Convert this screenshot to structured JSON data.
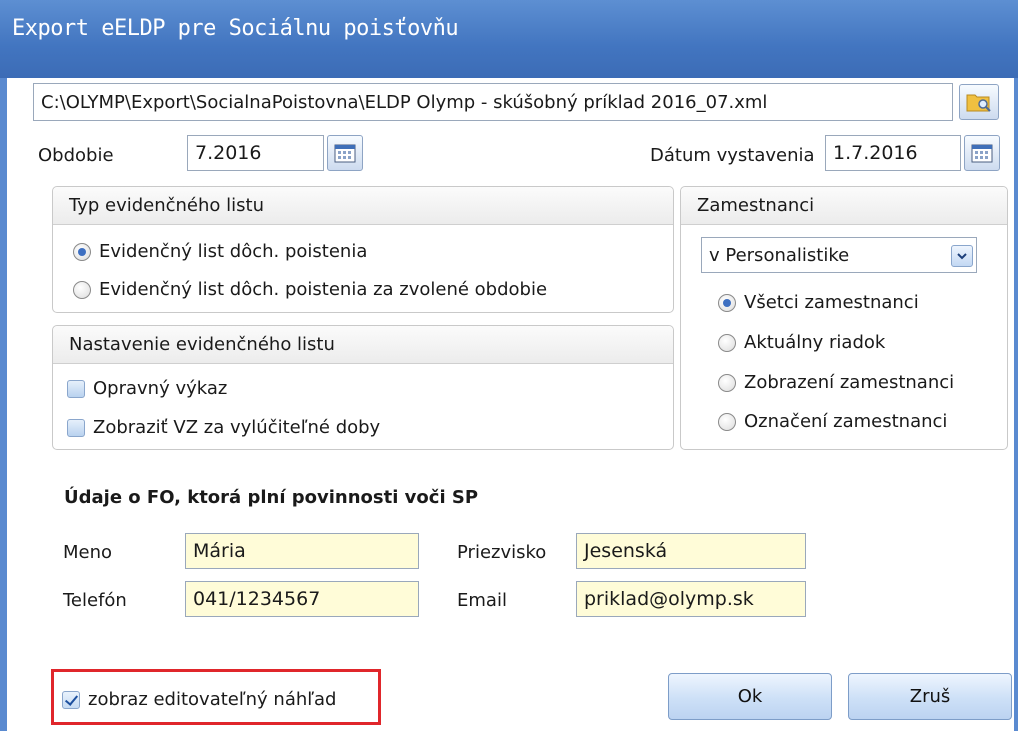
{
  "window": {
    "title": "Export eELDP pre Sociálnu poisťovňu"
  },
  "file": {
    "path": "C:\\OLYMP\\Export\\SocialnaPoistovna\\ELDP Olymp - skúšobný príklad 2016_07.xml",
    "browse_icon": "folder-search-icon"
  },
  "period": {
    "label": "Obdobie",
    "value": "7.2016",
    "icon": "calendar-icon"
  },
  "issue_date": {
    "label": "Dátum vystavenia",
    "value": "1.7.2016",
    "icon": "calendar-icon"
  },
  "list_type": {
    "title": "Typ evidenčného listu",
    "options": [
      {
        "label": "Evidenčný list dôch. poistenia",
        "selected": true
      },
      {
        "label": "Evidenčný list dôch. poistenia za zvolené obdobie",
        "selected": false
      }
    ]
  },
  "list_settings": {
    "title": "Nastavenie evidenčného listu",
    "options": [
      {
        "label": "Opravný výkaz",
        "checked": false
      },
      {
        "label": "Zobraziť VZ za vylúčiteľné doby",
        "checked": false
      }
    ]
  },
  "employees": {
    "title": "Zamestnanci",
    "source": "v Personalistike",
    "options": [
      {
        "label": "Všetci zamestnanci",
        "selected": true
      },
      {
        "label": "Aktuálny riadok",
        "selected": false
      },
      {
        "label": "Zobrazení zamestnanci",
        "selected": false
      },
      {
        "label": "Označení zamestnanci",
        "selected": false
      }
    ]
  },
  "person": {
    "title": "Údaje o FO, ktorá plní povinnosti voči SP",
    "first_name_label": "Meno",
    "first_name": "Mária",
    "last_name_label": "Priezvisko",
    "last_name": "Jesenská",
    "phone_label": "Telefón",
    "phone": "041/1234567",
    "email_label": "Email",
    "email": "priklad@olymp.sk"
  },
  "footer": {
    "preview_label": "zobraz editovateľný náhľad",
    "preview_checked": true,
    "ok_label": "Ok",
    "cancel_label": "Zruš"
  },
  "colors": {
    "title_bar": "#4a7ec8",
    "input_highlight": "#fffcd8",
    "annotation_red": "#e0262b"
  }
}
